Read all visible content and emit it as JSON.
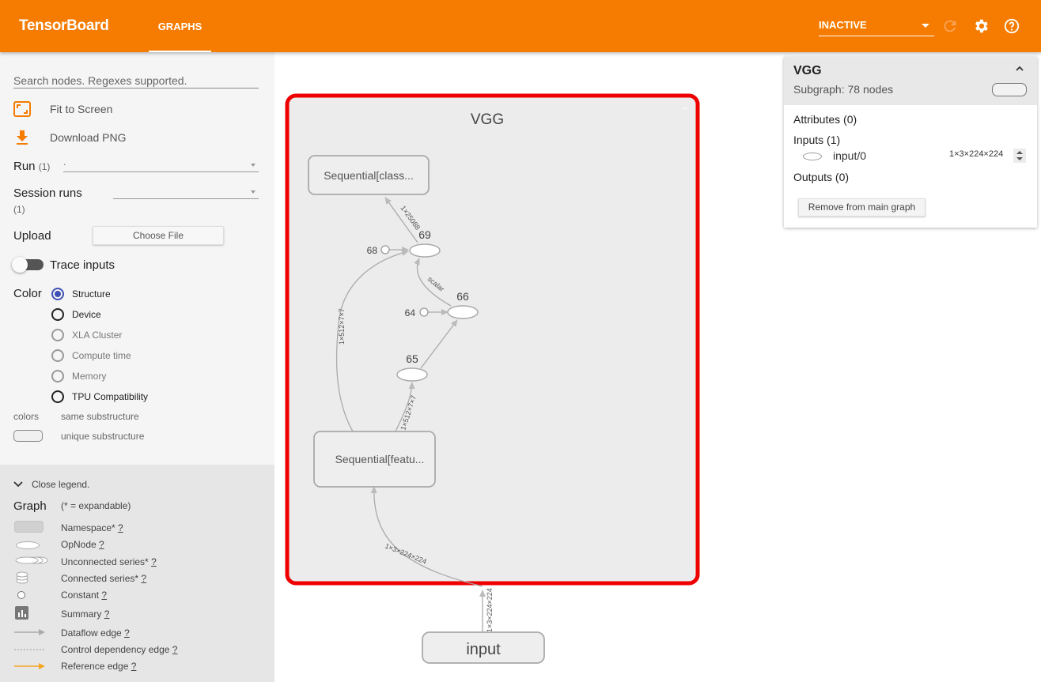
{
  "header": {
    "brand": "TensorBoard",
    "tab_graphs": "GRAPHS",
    "run_status": "INACTIVE",
    "accent_color": "#f57c00",
    "icons": [
      "refresh-icon",
      "gear-icon",
      "help-icon"
    ]
  },
  "sidebar": {
    "search_placeholder": "Search nodes. Regexes supported.",
    "fit_to_screen": "Fit to Screen",
    "download_png": "Download PNG",
    "run_label": "Run",
    "run_count": "(1)",
    "run_value": ".",
    "session_runs_label": "Session runs",
    "session_runs_count": "(1)",
    "upload_label": "Upload",
    "choose_file": "Choose File",
    "trace_inputs": "Trace inputs",
    "color_label": "Color",
    "color_options": [
      "Structure",
      "Device",
      "XLA Cluster",
      "Compute time",
      "Memory",
      "TPU Compatibility"
    ],
    "selected_color": "Structure",
    "colors_label": "colors",
    "same_substructure": "same substructure",
    "unique_substructure": "unique substructure"
  },
  "legend": {
    "close_legend": "Close legend.",
    "graph_label": "Graph",
    "expandable_note": "(* = expandable)",
    "items": [
      {
        "label": "Namespace*",
        "help": "?"
      },
      {
        "label": "OpNode",
        "help": "?"
      },
      {
        "label": "Unconnected series*",
        "help": "?"
      },
      {
        "label": "Connected series*",
        "help": "?"
      },
      {
        "label": "Constant",
        "help": "?"
      },
      {
        "label": "Summary",
        "help": "?"
      },
      {
        "label": "Dataflow edge",
        "help": "?"
      },
      {
        "label": "Control dependency edge",
        "help": "?"
      },
      {
        "label": "Reference edge",
        "help": "?"
      }
    ]
  },
  "graph": {
    "group_title": "VGG",
    "collapse_glyph": "–",
    "nodes": {
      "classifier": "Sequential[class...",
      "features": "Sequential[featu...",
      "input": "input",
      "n69": "69",
      "n68": "68",
      "n66": "66",
      "n64": "64",
      "n65": "65"
    },
    "edges": {
      "e_classifier": "1×25088",
      "e_scalar": "scalar",
      "e_skip": "1×512×7×7",
      "e_65": "1×512×7×7",
      "e_features": "1×3×224×224",
      "e_input": "1×3×224×224"
    },
    "highlight_color": "#ee0000"
  },
  "info_card": {
    "title": "VGG",
    "subtitle": "Subgraph: 78 nodes",
    "attributes": "Attributes (0)",
    "inputs": "Inputs (1)",
    "input_name": "input/0",
    "input_shape": "1×3×224×224",
    "outputs": "Outputs (0)",
    "remove_button": "Remove from main graph"
  }
}
